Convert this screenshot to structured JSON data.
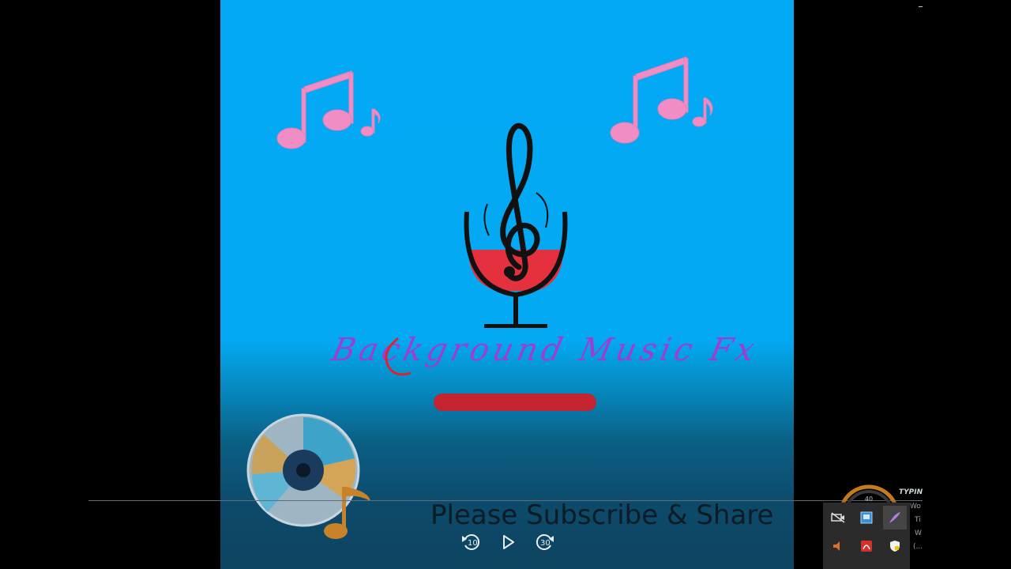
{
  "video": {
    "title_text": "Background Music Fx",
    "subscribe_text": "Please Subscribe & Share"
  },
  "controls": {
    "rewind_seconds": "10",
    "forward_seconds": "30"
  },
  "gadget": {
    "typing_label": "TYPING",
    "lines": [
      "Wo",
      "Ti",
      "W",
      "(..."
    ],
    "gauge_value": "40"
  },
  "tray": {
    "icons": [
      "hidden-camera-icon",
      "network-icon",
      "feather-pen-icon",
      "speaker-icon",
      "pdf-reader-icon",
      "security-shield-icon"
    ]
  },
  "colors": {
    "background_blue": "#03a9f4",
    "note_pink": "#f28cc4",
    "title_purple": "#9b3fd2",
    "bar_red": "#c4242f",
    "wine_red": "#e5303e"
  }
}
